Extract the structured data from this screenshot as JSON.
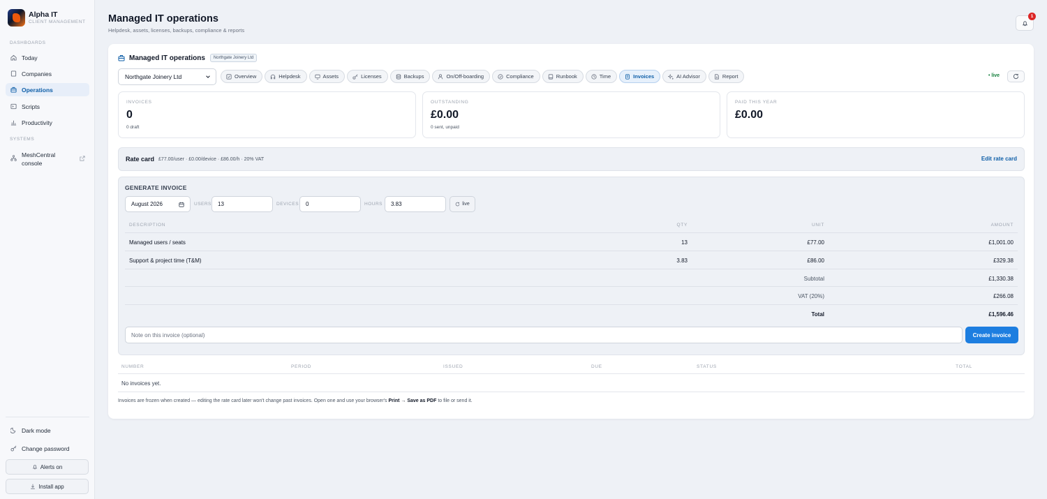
{
  "brand": {
    "title": "Alpha IT",
    "subtitle": "CLIENT MANAGEMENT"
  },
  "sidebar": {
    "sections": [
      {
        "label": "DASHBOARDS"
      },
      {
        "label": "SYSTEMS"
      }
    ],
    "items": [
      {
        "label": "Today",
        "icon": "home-icon"
      },
      {
        "label": "Companies",
        "icon": "building-icon"
      },
      {
        "label": "Operations",
        "icon": "briefcase-icon",
        "active": true
      },
      {
        "label": "Scripts",
        "icon": "terminal-icon"
      },
      {
        "label": "Productivity",
        "icon": "bar-chart-icon"
      },
      {
        "label": "MeshCentral console",
        "icon": "network-icon",
        "external": true
      }
    ],
    "bottom": {
      "dark_mode": "Dark mode",
      "change_password": "Change password",
      "alerts": "Alerts on",
      "install": "Install app"
    }
  },
  "header": {
    "title": "Managed IT operations",
    "subtitle": "Helpdesk, assets, licenses, backups, compliance & reports",
    "notification_count": "1"
  },
  "panel": {
    "title": "Managed IT operations",
    "company_chip": "Northgate Joinery Ltd",
    "company_select": "Northgate Joinery Ltd",
    "tabs": [
      {
        "label": "Overview",
        "icon": "checkbox-icon"
      },
      {
        "label": "Helpdesk",
        "icon": "headset-icon"
      },
      {
        "label": "Assets",
        "icon": "monitor-icon"
      },
      {
        "label": "Licenses",
        "icon": "key-icon"
      },
      {
        "label": "Backups",
        "icon": "database-icon"
      },
      {
        "label": "On/Off-boarding",
        "icon": "user-icon"
      },
      {
        "label": "Compliance",
        "icon": "shield-check-icon"
      },
      {
        "label": "Runbook",
        "icon": "book-icon"
      },
      {
        "label": "Time",
        "icon": "clock-icon"
      },
      {
        "label": "Invoices",
        "icon": "receipt-icon",
        "active": true
      },
      {
        "label": "AI Advisor",
        "icon": "sparkle-icon"
      },
      {
        "label": "Report",
        "icon": "file-icon"
      }
    ],
    "live_label": "• live"
  },
  "stats": [
    {
      "label": "INVOICES",
      "value": "0",
      "sub": "0 draft"
    },
    {
      "label": "OUTSTANDING",
      "value": "£0.00",
      "sub": "0 sent, unpaid"
    },
    {
      "label": "PAID THIS YEAR",
      "value": "£0.00",
      "sub": ""
    }
  ],
  "ratecard": {
    "title": "Rate card",
    "detail": "£77.00/user · £0.00/device · £86.00/h · 20% VAT",
    "edit": "Edit rate card"
  },
  "generate": {
    "title": "GENERATE INVOICE",
    "month": "August  2026",
    "users_label": "USERS",
    "users": "13",
    "devices_label": "DEVICES",
    "devices": "0",
    "hours_label": "HOURS",
    "hours": "3.83",
    "live_button": "live",
    "columns": {
      "description": "DESCRIPTION",
      "qty": "QTY",
      "unit": "UNIT",
      "amount": "AMOUNT"
    },
    "lines": [
      {
        "description": "Managed users / seats",
        "qty": "13",
        "unit": "£77.00",
        "amount": "£1,001.00"
      },
      {
        "description": "Support & project time (T&M)",
        "qty": "3.83",
        "unit": "£86.00",
        "amount": "£329.38"
      }
    ],
    "subtotal_label": "Subtotal",
    "subtotal": "£1,330.38",
    "vat_label": "VAT (20%)",
    "vat": "£266.08",
    "total_label": "Total",
    "total": "£1,596.46",
    "note_placeholder": "Note on this invoice (optional)",
    "create_button": "Create invoice"
  },
  "invoices": {
    "columns": {
      "number": "NUMBER",
      "period": "PERIOD",
      "issued": "ISSUED",
      "due": "DUE",
      "status": "STATUS",
      "total": "TOTAL"
    },
    "empty": "No invoices yet."
  },
  "footnote": {
    "before": "Invoices are frozen when created — editing the rate card later won't change past invoices. Open one and use your browser's ",
    "bold": "Print → Save as PDF",
    "after": " to file or send it."
  }
}
